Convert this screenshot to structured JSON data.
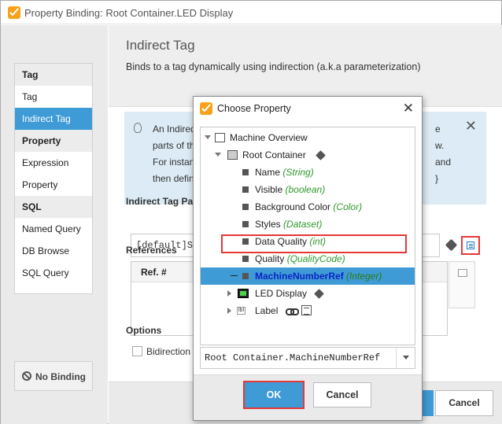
{
  "window": {
    "title": "Property Binding: Root Container.LED Display"
  },
  "nav": {
    "sections": [
      {
        "header": "Tag",
        "items": [
          {
            "label": "Tag"
          },
          {
            "label": "Indirect Tag",
            "selected": true
          }
        ]
      },
      {
        "header": "Property",
        "items": [
          {
            "label": "Expression"
          },
          {
            "label": "Property"
          }
        ]
      },
      {
        "header": "SQL",
        "items": [
          {
            "label": "Named Query"
          },
          {
            "label": "DB Browse"
          },
          {
            "label": "SQL Query"
          }
        ]
      }
    ],
    "no_binding": "No Binding"
  },
  "content": {
    "title": "Indirect Tag",
    "subtitle": "Binds to a tag dynamically using indirection (a.k.a parameterization)",
    "info_lines": [
      "An Indired",
      "parts of th",
      "For instan",
      "then defin"
    ],
    "info_lines_right": [
      "e",
      "w.",
      "and",
      "}"
    ],
    "path_label": "Indirect Tag Pat",
    "path_value": "[default]Si",
    "references_label": "References",
    "ref_header": "Ref. #",
    "options_label": "Options",
    "bidirectional": "Bidirection",
    "cancel": "Cancel"
  },
  "modal": {
    "title": "Choose Property",
    "tree": [
      {
        "label": "Machine Overview",
        "type": ""
      },
      {
        "label": "Root Container",
        "type": ""
      },
      {
        "label": "Name",
        "type": "(String)"
      },
      {
        "label": "Visible",
        "type": "(boolean)"
      },
      {
        "label": "Background Color",
        "type": "(Color)"
      },
      {
        "label": "Styles",
        "type": "(Dataset)"
      },
      {
        "label": "Data Quality",
        "type": "(int)"
      },
      {
        "label": "Quality",
        "type": "(QualityCode)"
      },
      {
        "label": "MachineNumberRef",
        "type": "(Integer)"
      },
      {
        "label": "LED Display",
        "type": ""
      },
      {
        "label": "Label",
        "type": ""
      }
    ],
    "selected_path": "Root Container.MachineNumberRef",
    "ok": "OK",
    "cancel": "Cancel"
  }
}
